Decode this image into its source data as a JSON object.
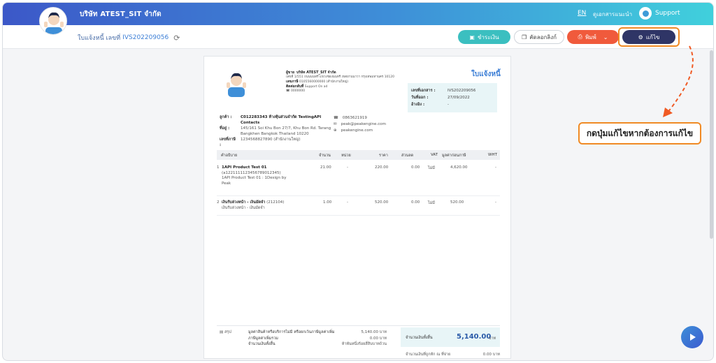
{
  "topbar": {
    "company": "บริษัท ATEST_SIT จำกัด",
    "lang": "EN",
    "help": "ดูเอกสารแนะนำ",
    "support": "Support"
  },
  "subbar": {
    "doc_label": "ใบแจ้งหนี้ เลขที่",
    "doc_number": "IVS202209056",
    "buttons": {
      "pay": "ชำระเงิน",
      "copy": "คัดลอกลิงก์",
      "print": "พิมพ์",
      "edit": "แก้ไข"
    }
  },
  "document": {
    "title": "ใบแจ้งหนี้",
    "seller": {
      "label": "ผู้ขาย",
      "name": "บริษัท ATEST_SIT จำกัด",
      "address": "เลขที่ 1/551 ถนนนนทรี แขวงช่องนนทรี เขตยานนาวา กรุงเทพมหานคร 10120",
      "tax_label": "เลขภาษี",
      "tax_value": "0105560000000 (สำนักงานใหญ่)",
      "contact_label": "ติดต่อกลับที่",
      "contact_value": "Support On ad",
      "phone": "0000000"
    },
    "meta": [
      {
        "k": "เลขที่เอกสาร :",
        "v": "IVS202209056"
      },
      {
        "k": "วันที่ออก :",
        "v": "27/09/2022"
      },
      {
        "k": "อ้างอิง :",
        "v": "-"
      }
    ],
    "customer": {
      "customer_label": "ลูกค้า :",
      "customer_value": "C012283343 ห้างหุ้นส่วนจำกัด TestingAPI Contacts",
      "address_label": "ที่อยู่ :",
      "address_value": "145/161 Soi Khu Bon 27/7, Khu Bon Rd. Tarang Bangkhen Bangkok Thailand 10220",
      "tax_label": "เลขที่ภาษี :",
      "tax_value": "1234568827890 (สำนักงานใหญ่)"
    },
    "contact": {
      "phone": "0863621919",
      "email": "peak@peakengine.com",
      "web": "peakengine.com"
    },
    "columns": {
      "desc": "คำอธิบาย",
      "qty": "จำนวน",
      "unit": "หน่วย",
      "price": "ราคา",
      "discount": "ส่วนลด",
      "vat": "VAT",
      "amount": "มูลค่าก่อนภาษี",
      "wht": "WHT"
    },
    "items": [
      {
        "no": "1",
        "name": "1API Product Test 01",
        "code": "(a1221111123456789012345)",
        "note": "1API Product Test 01 : 1Design by Peak",
        "qty": "21.00",
        "unit": "-",
        "price": "220.00",
        "discount": "0.00",
        "vat": "ไม่มี",
        "amount": "4,620.00",
        "wht": "-"
      },
      {
        "no": "2",
        "name": "เงินรับล่วงหน้า - เงินมัดจำ",
        "code": "(212104)",
        "note": "เงินรับล่วงหน้า - เงินมัดจำ",
        "qty": "1.00",
        "unit": "-",
        "price": "520.00",
        "discount": "0.00",
        "vat": "ไม่มี",
        "amount": "520.00",
        "wht": "-"
      }
    ],
    "summary": {
      "label": "สรุป",
      "l1": "มูลค่าสินค้าหรือบริการไม่มี หรือยกเว้นภาษีมูลค่าเพิ่ม",
      "l2": "ภาษีมูลค่าเพิ่มรวม",
      "l3": "จำนวนเงินทั้งสิ้น",
      "v1": "5,140.00 บาท",
      "v2": "0.00 บาท",
      "v3": "ห้าพันหนึ่งร้อยสี่สิบบาทถ้วน",
      "total_label": "จำนวนเงินทั้งสิ้น",
      "total_value": "5,140.00",
      "total_unit": "บาท",
      "extra_label": "จำนวนเงินที่ถูกหัก ณ ที่จ่าย",
      "extra_value": "0.00 บาท"
    }
  },
  "callout": {
    "text": "กดปุ่มแก้ไขหากต้องการแก้ไข"
  },
  "colors": {
    "accent": "#3d7fd6",
    "highlight": "#f08a24",
    "edit_button": "#2f3566",
    "pay_button": "#3bbfc0",
    "print_button": "#f05a3c"
  }
}
